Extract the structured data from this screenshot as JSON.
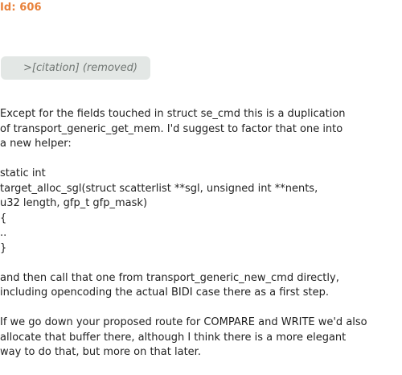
{
  "header": {
    "id_label": "Id: 606"
  },
  "citation": {
    "text": ">[citation] (removed)"
  },
  "paragraphs": [
    {
      "lines": [
        "Except for the fields touched in struct se_cmd this is a duplication",
        "of transport_generic_get_mem. I'd suggest to factor that one into",
        "a new helper:"
      ]
    },
    {
      "lines": [
        "static int",
        "target_alloc_sgl(struct scatterlist **sgl, unsigned int **nents,",
        "u32 length, gfp_t gfp_mask)",
        "{",
        "..",
        "}"
      ]
    },
    {
      "lines": [
        "and then call that one from transport_generic_new_cmd directly,",
        "including opencoding the actual BIDI case there as a first step."
      ]
    },
    {
      "lines": [
        "If we go down your proposed route for COMPARE and WRITE we'd also",
        "allocate that buffer there, although I think there is a more elegant",
        "way to do that, but more on that later."
      ]
    }
  ],
  "colors": {
    "id_label": "#e8813a",
    "citation_bg": "#e3e7e5",
    "citation_text": "#6f7572",
    "body_text": "#1f1f1f"
  }
}
